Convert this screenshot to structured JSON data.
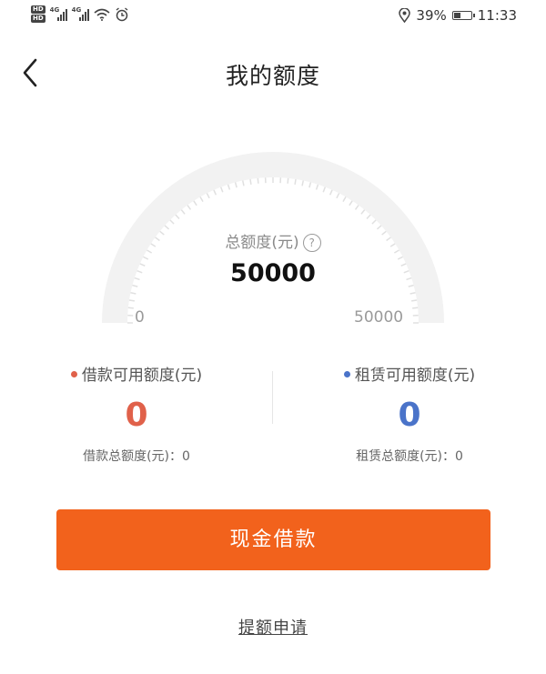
{
  "status_bar": {
    "hd1": "HD",
    "hd2": "HD",
    "net1": "4G",
    "net2": "4G",
    "battery": "39%",
    "battery_level": 0.39,
    "time": "11:33",
    "icons": [
      "wifi-icon",
      "alarm-icon",
      "location-icon",
      "battery-icon"
    ]
  },
  "header": {
    "title": "我的额度"
  },
  "gauge": {
    "total_label": "总额度(元)",
    "help": "?",
    "total_value": "50000",
    "min_label": "0",
    "max_label": "50000"
  },
  "loan": {
    "label": "借款可用额度(元)",
    "value": "0",
    "total_text": "借款总额度(元)：0",
    "color": "#e0614a"
  },
  "lease": {
    "label": "租赁可用额度(元)",
    "value": "0",
    "total_text": "租赁总额度(元)：0",
    "color": "#4a73c9"
  },
  "actions": {
    "cash_loan": "现金借款",
    "increase": "提额申请",
    "button_color": "#f2621c"
  }
}
